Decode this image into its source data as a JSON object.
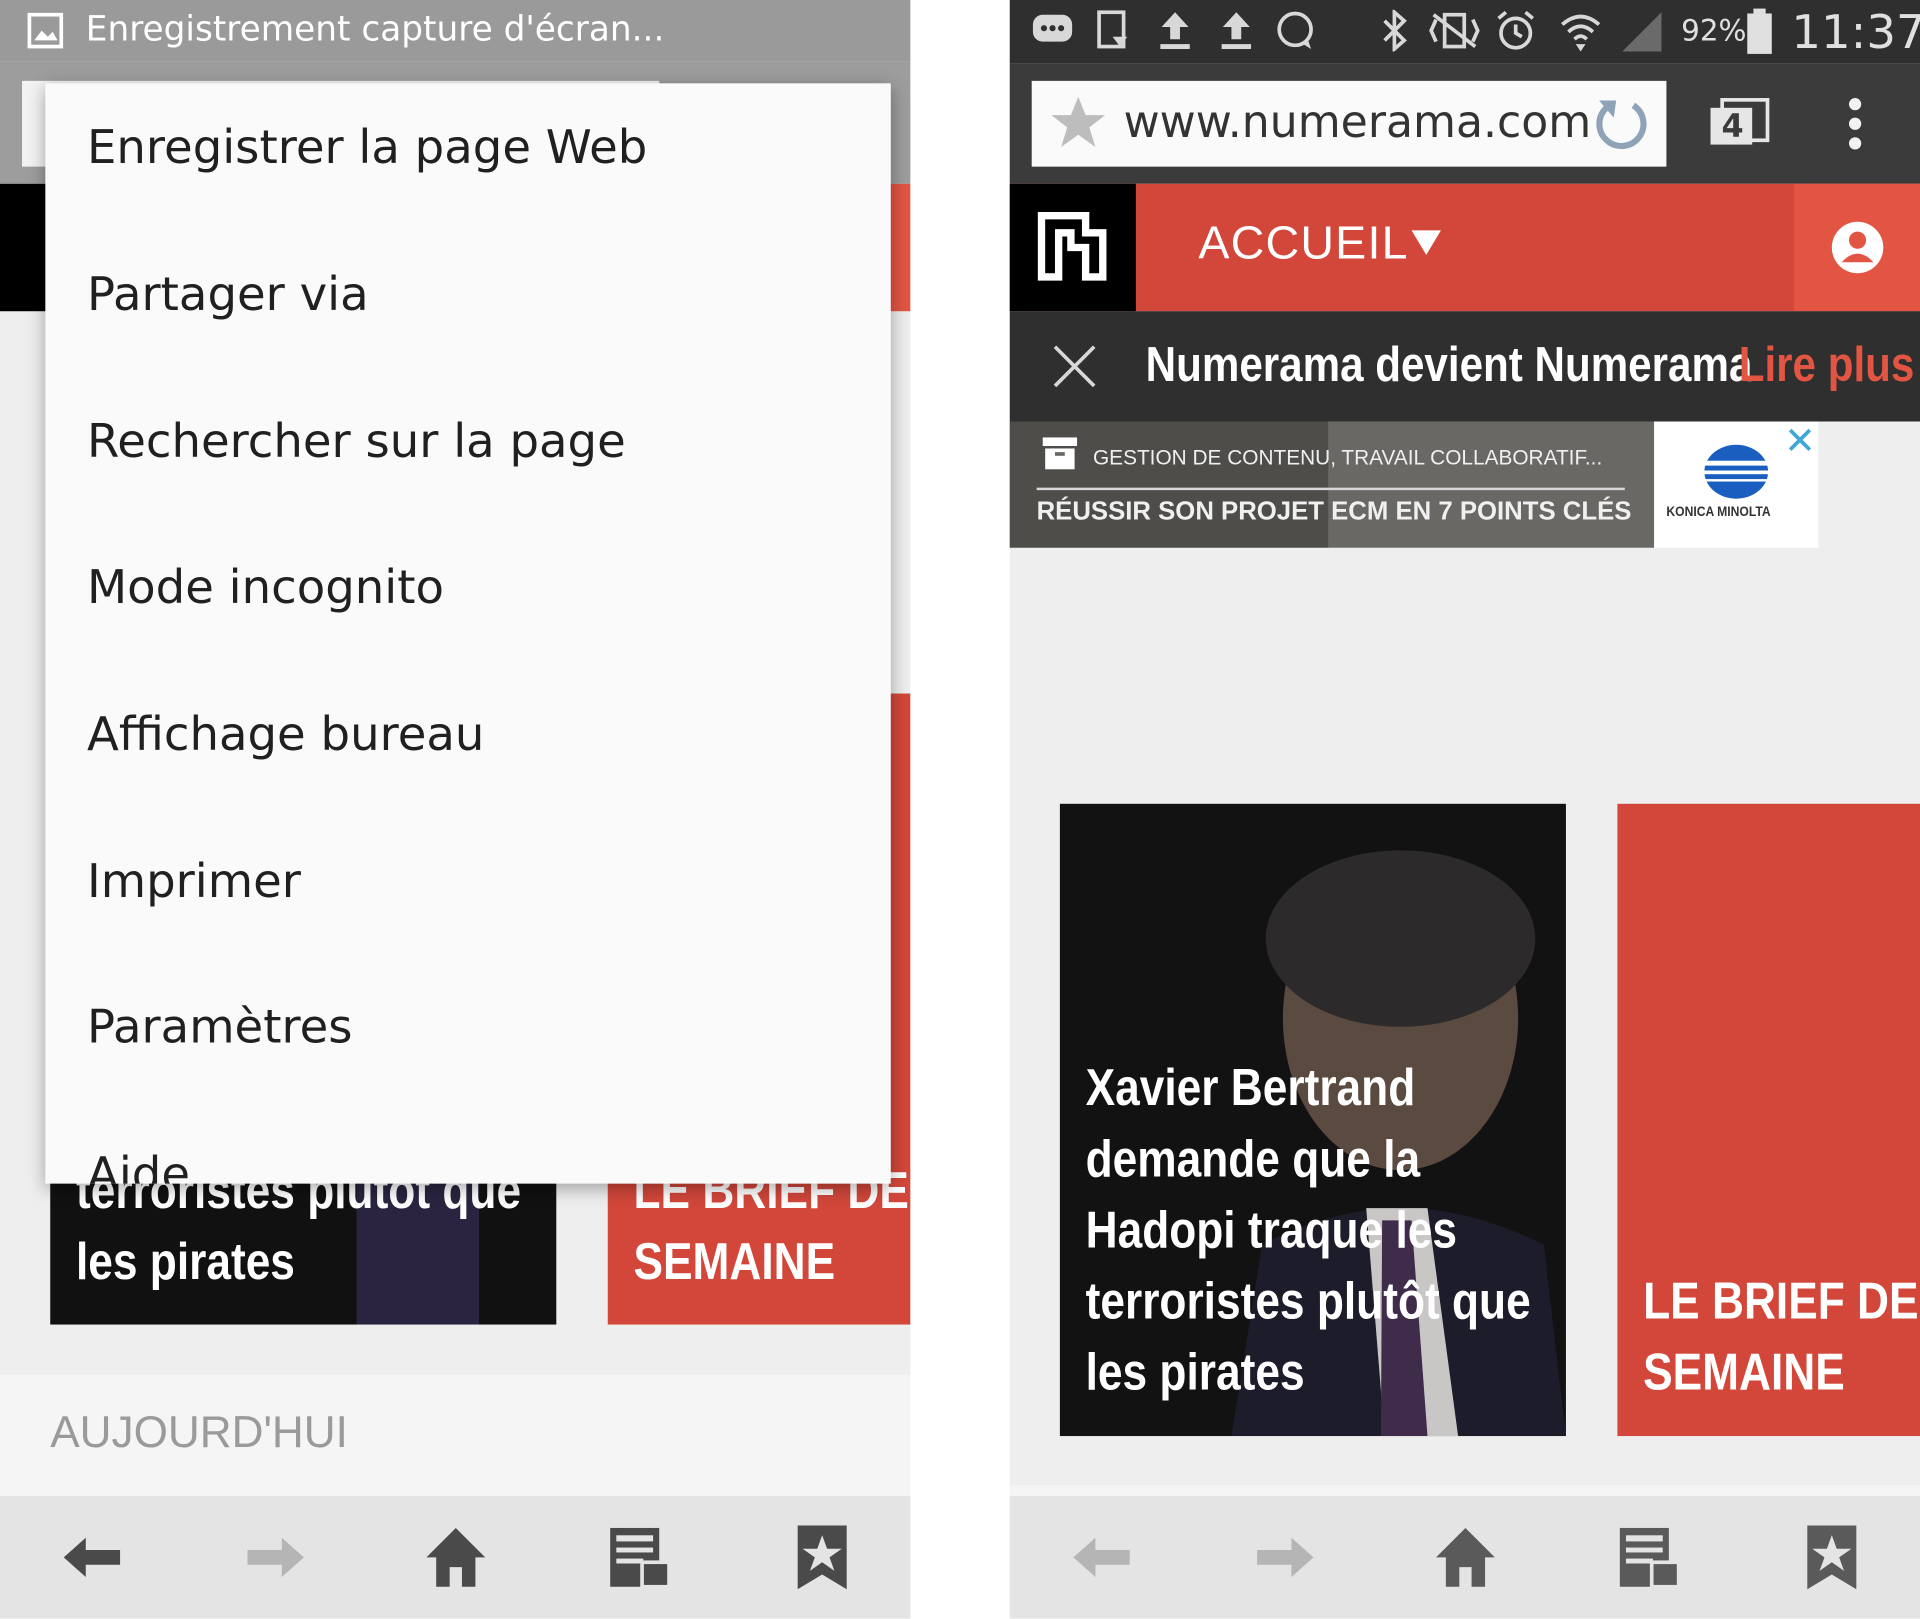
{
  "left_screen": {
    "notification": {
      "text": "Enregistrement capture d'écran..."
    },
    "menu": {
      "items": [
        "Enregistrer la page Web",
        "Partager via",
        "Rechercher sur la page",
        "Mode incognito",
        "Affichage bureau",
        "Imprimer",
        "Paramètres",
        "Aide"
      ]
    },
    "article_visible": [
      "terroristes plutôt que",
      "les pirates"
    ],
    "brief_visible": [
      "LE BRIEF DE LA",
      "SEMAINE"
    ],
    "section_heading": "AUJOURD'HUI"
  },
  "right_screen": {
    "status_bar": {
      "battery": "92%",
      "time": "11:37"
    },
    "address_bar": {
      "url": "www.numerama.com",
      "tab_count": "4"
    },
    "site_header": {
      "nav_label": "ACCUEIL"
    },
    "banner": {
      "text": "Numerama devient Numerama",
      "link": "Lire plus"
    },
    "ad": {
      "line1": "GESTION DE CONTENU, TRAVAIL COLLABORATIF...",
      "line2": "RÉUSSIR SON PROJET ECM EN 7 POINTS CLÉS",
      "brand": "KONICA MINOLTA"
    },
    "article_card": {
      "title_lines": [
        "Xavier Bertrand",
        "demande que la",
        "Hadopi traque les",
        "terroristes plutôt que",
        "les pirates"
      ]
    },
    "brief_card": {
      "lines": [
        "LE BRIEF DE LA",
        "SEMAINE"
      ]
    }
  },
  "colors": {
    "brand_red": "#d2473a",
    "accent_red": "#e25542",
    "dark": "#000000",
    "toolbar": "#3b3b3b"
  }
}
